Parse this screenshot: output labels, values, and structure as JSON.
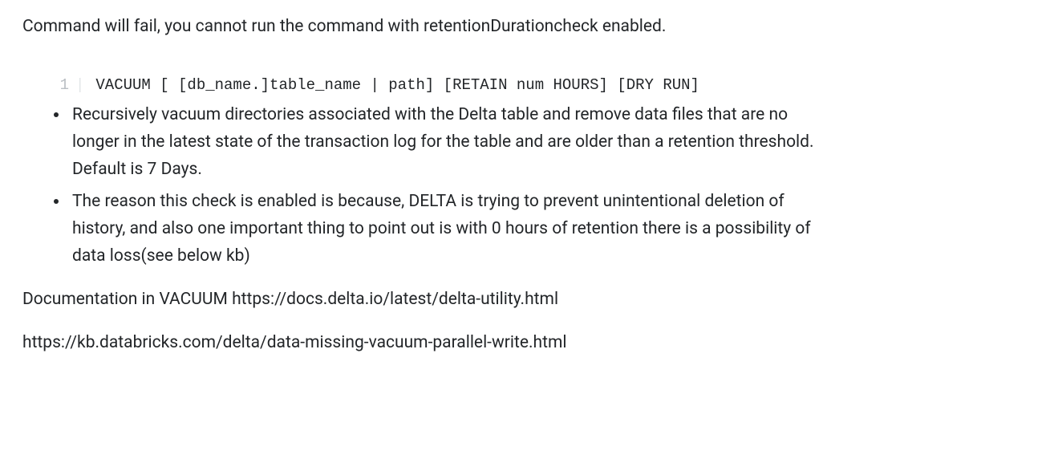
{
  "intro": "Command will fail, you cannot run the command with retentionDurationcheck enabled.",
  "code": {
    "line_number": "1",
    "content": "VACUUM [ [db_name.]table_name | path] [RETAIN num HOURS] [DRY RUN]"
  },
  "bullets": [
    "Recursively vacuum directories associated with the Delta table and remove data files that are no longer in the latest state of the transaction log for the table and are older than a retention threshold. Default is 7 Days.",
    "The reason this check is enabled is because, DELTA is trying to prevent unintentional deletion of history, and also one important thing to point out is with 0 hours of retention there is a possibility of data loss(see below kb)"
  ],
  "doc_line_prefix": "Documentation in VACUUM ",
  "doc_link": "https://docs.delta.io/latest/delta-utility.html",
  "kb_link": "https://kb.databricks.com/delta/data-missing-vacuum-parallel-write.html"
}
